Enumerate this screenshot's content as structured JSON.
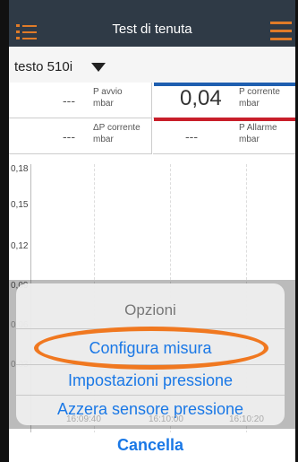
{
  "header": {
    "title": "Test di tenuta"
  },
  "device": {
    "name": "testo 510i"
  },
  "values": {
    "p_avvio": {
      "value": "---",
      "label": "P avvio",
      "unit": "mbar"
    },
    "p_corrente": {
      "value": "0,04",
      "label": "P corrente",
      "unit": "mbar"
    },
    "delta_p": {
      "value": "---",
      "label": "ΔP corrente",
      "unit": "mbar"
    },
    "p_allarme": {
      "value": "---",
      "label": "P Allarme",
      "unit": "mbar"
    }
  },
  "chart_data": {
    "type": "line",
    "y_ticks": [
      "0,18",
      "0,15",
      "0,12",
      "0,09",
      "0,06",
      "0,03"
    ],
    "x_ticks": [
      "16:09:40",
      "16:10:00",
      "16:10:20"
    ],
    "series": []
  },
  "action_sheet": {
    "title": "Opzioni",
    "options": [
      "Configura misura",
      "Impostazioni pressione",
      "Azzera sensore pressione"
    ],
    "cancel": "Cancella"
  },
  "colors": {
    "header_bg": "#2f3a46",
    "accent": "#e07b28",
    "link": "#1a78e6",
    "blue_bar": "#1f5fb0",
    "red_bar": "#c81e2a"
  }
}
